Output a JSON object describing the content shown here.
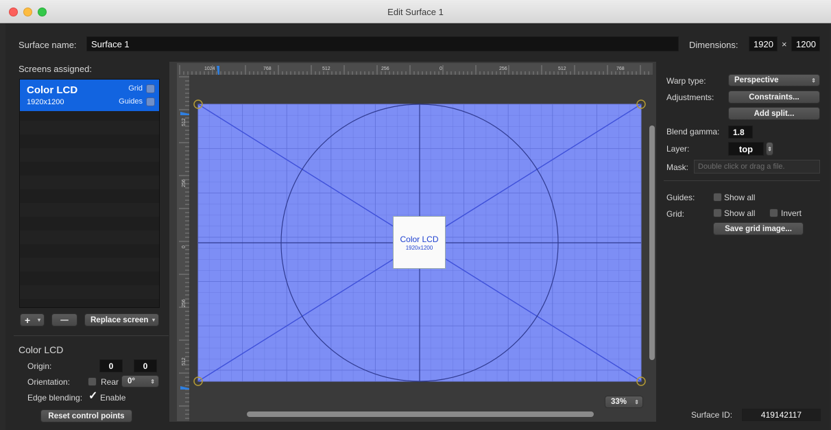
{
  "window": {
    "title": "Edit Surface 1"
  },
  "surface": {
    "name_label": "Surface name:",
    "name_value": "Surface 1",
    "dimensions_label": "Dimensions:",
    "width": "1920",
    "times": "×",
    "height": "1200"
  },
  "screens": {
    "label": "Screens assigned:",
    "items": [
      {
        "name": "Color LCD",
        "dims": "1920x1200",
        "grid_label": "Grid",
        "guides_label": "Guides"
      }
    ],
    "add_label": "+",
    "add_arrow": "▾",
    "remove_label": "—",
    "replace_label": "Replace screen",
    "replace_arrow": "▾"
  },
  "screen_props": {
    "title": "Color LCD",
    "origin_label": "Origin:",
    "origin_x": "0",
    "origin_y": "0",
    "orientation_label": "Orientation:",
    "rear_label": "Rear",
    "rotation": "0°",
    "edge_label": "Edge blending:",
    "enable_label": "Enable",
    "enable_checked": true,
    "reset_label": "Reset control points"
  },
  "canvas": {
    "h_ticks": [
      "1024",
      "768",
      "512",
      "256",
      "0",
      "256",
      "512",
      "768"
    ],
    "v_ticks": [
      "512",
      "256",
      "0",
      "256",
      "512"
    ],
    "screen_label": "Color LCD",
    "screen_dims": "1920x1200",
    "zoom": "33%",
    "surface_color": "#7d8ef5",
    "grid_color": "#5f6fd8",
    "line_color": "#3a49a8"
  },
  "right": {
    "warp_label": "Warp type:",
    "warp_value": "Perspective",
    "adjust_label": "Adjustments:",
    "constraints_label": "Constraints...",
    "add_split_label": "Add split...",
    "gamma_label": "Blend gamma:",
    "gamma_value": "1.8",
    "layer_label": "Layer:",
    "layer_value": "top",
    "mask_label": "Mask:",
    "mask_placeholder": "Double click or drag a file.",
    "guides_label": "Guides:",
    "guides_show_all": "Show all",
    "grid_label": "Grid:",
    "grid_show_all": "Show all",
    "grid_invert": "Invert",
    "save_grid_label": "Save grid image...",
    "surface_id_label": "Surface ID:",
    "surface_id_value": "419142117"
  }
}
